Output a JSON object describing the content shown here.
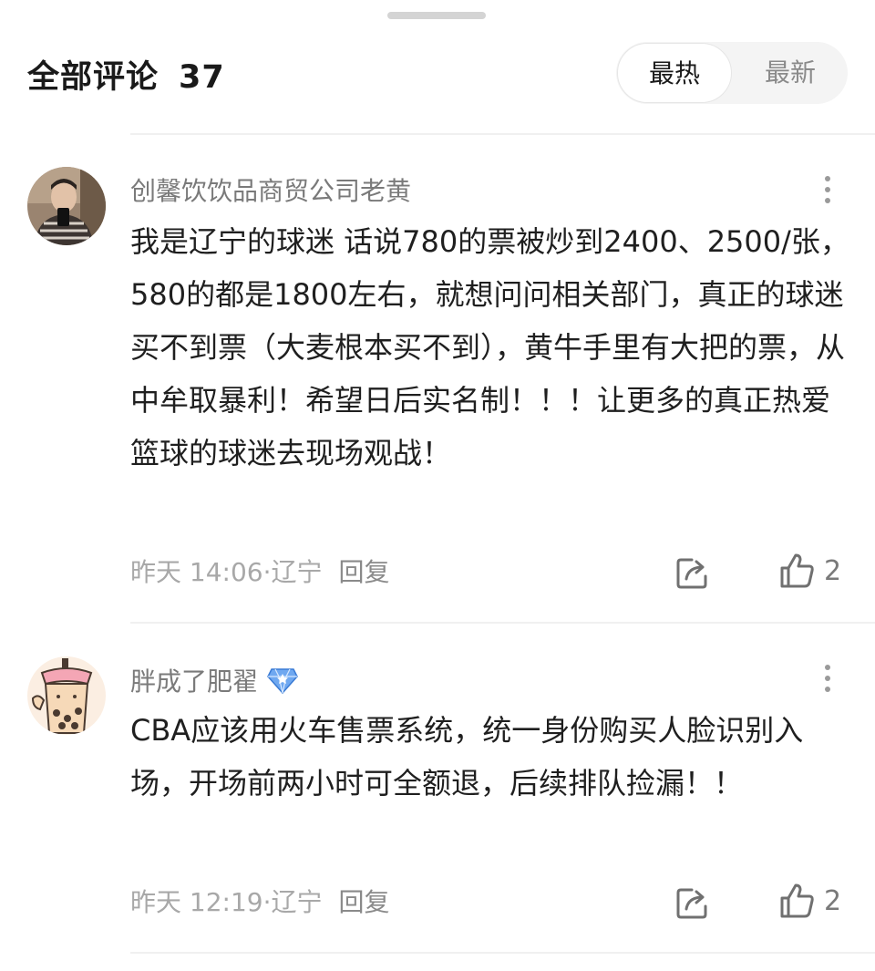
{
  "header": {
    "title": "全部评论",
    "count": "37",
    "sort_options": [
      {
        "label": "最热",
        "active": true
      },
      {
        "label": "最新",
        "active": false
      }
    ]
  },
  "comments": [
    {
      "username": "创馨饮饮品商贸公司老黄",
      "text": "我是辽宁的球迷 话说780的票被炒到2400、2500/张，580的都是1800左右，就想问问相关部门，真正的球迷买不到票（大麦根本买不到），黄牛手里有大把的票，从中牟取暴利！希望日后实名制！！！让更多的真正热爱篮球的球迷去现场观战！",
      "time_location": "昨天 14:06·辽宁",
      "reply_label": "回复",
      "likes": "2",
      "avatar_icon": "person-photo-avatar",
      "has_badge": false
    },
    {
      "username": "胖成了肥翟",
      "text": "CBA应该用火车售票系统，统一身份购买人脸识别入场，开场前两小时可全额退，后续排队捡漏！！",
      "time_location": "昨天 12:19·辽宁",
      "reply_label": "回复",
      "likes": "2",
      "avatar_icon": "bubble-tea-avatar",
      "has_badge": true,
      "badge_icon": "diamond-badge-icon"
    }
  ],
  "icons": {
    "more": "more-vertical-icon",
    "share": "share-icon",
    "like": "thumbs-up-icon"
  },
  "colors": {
    "username": "#7a7a7a",
    "meta": "#a8a8a8",
    "badge": "#3a7bd5"
  }
}
